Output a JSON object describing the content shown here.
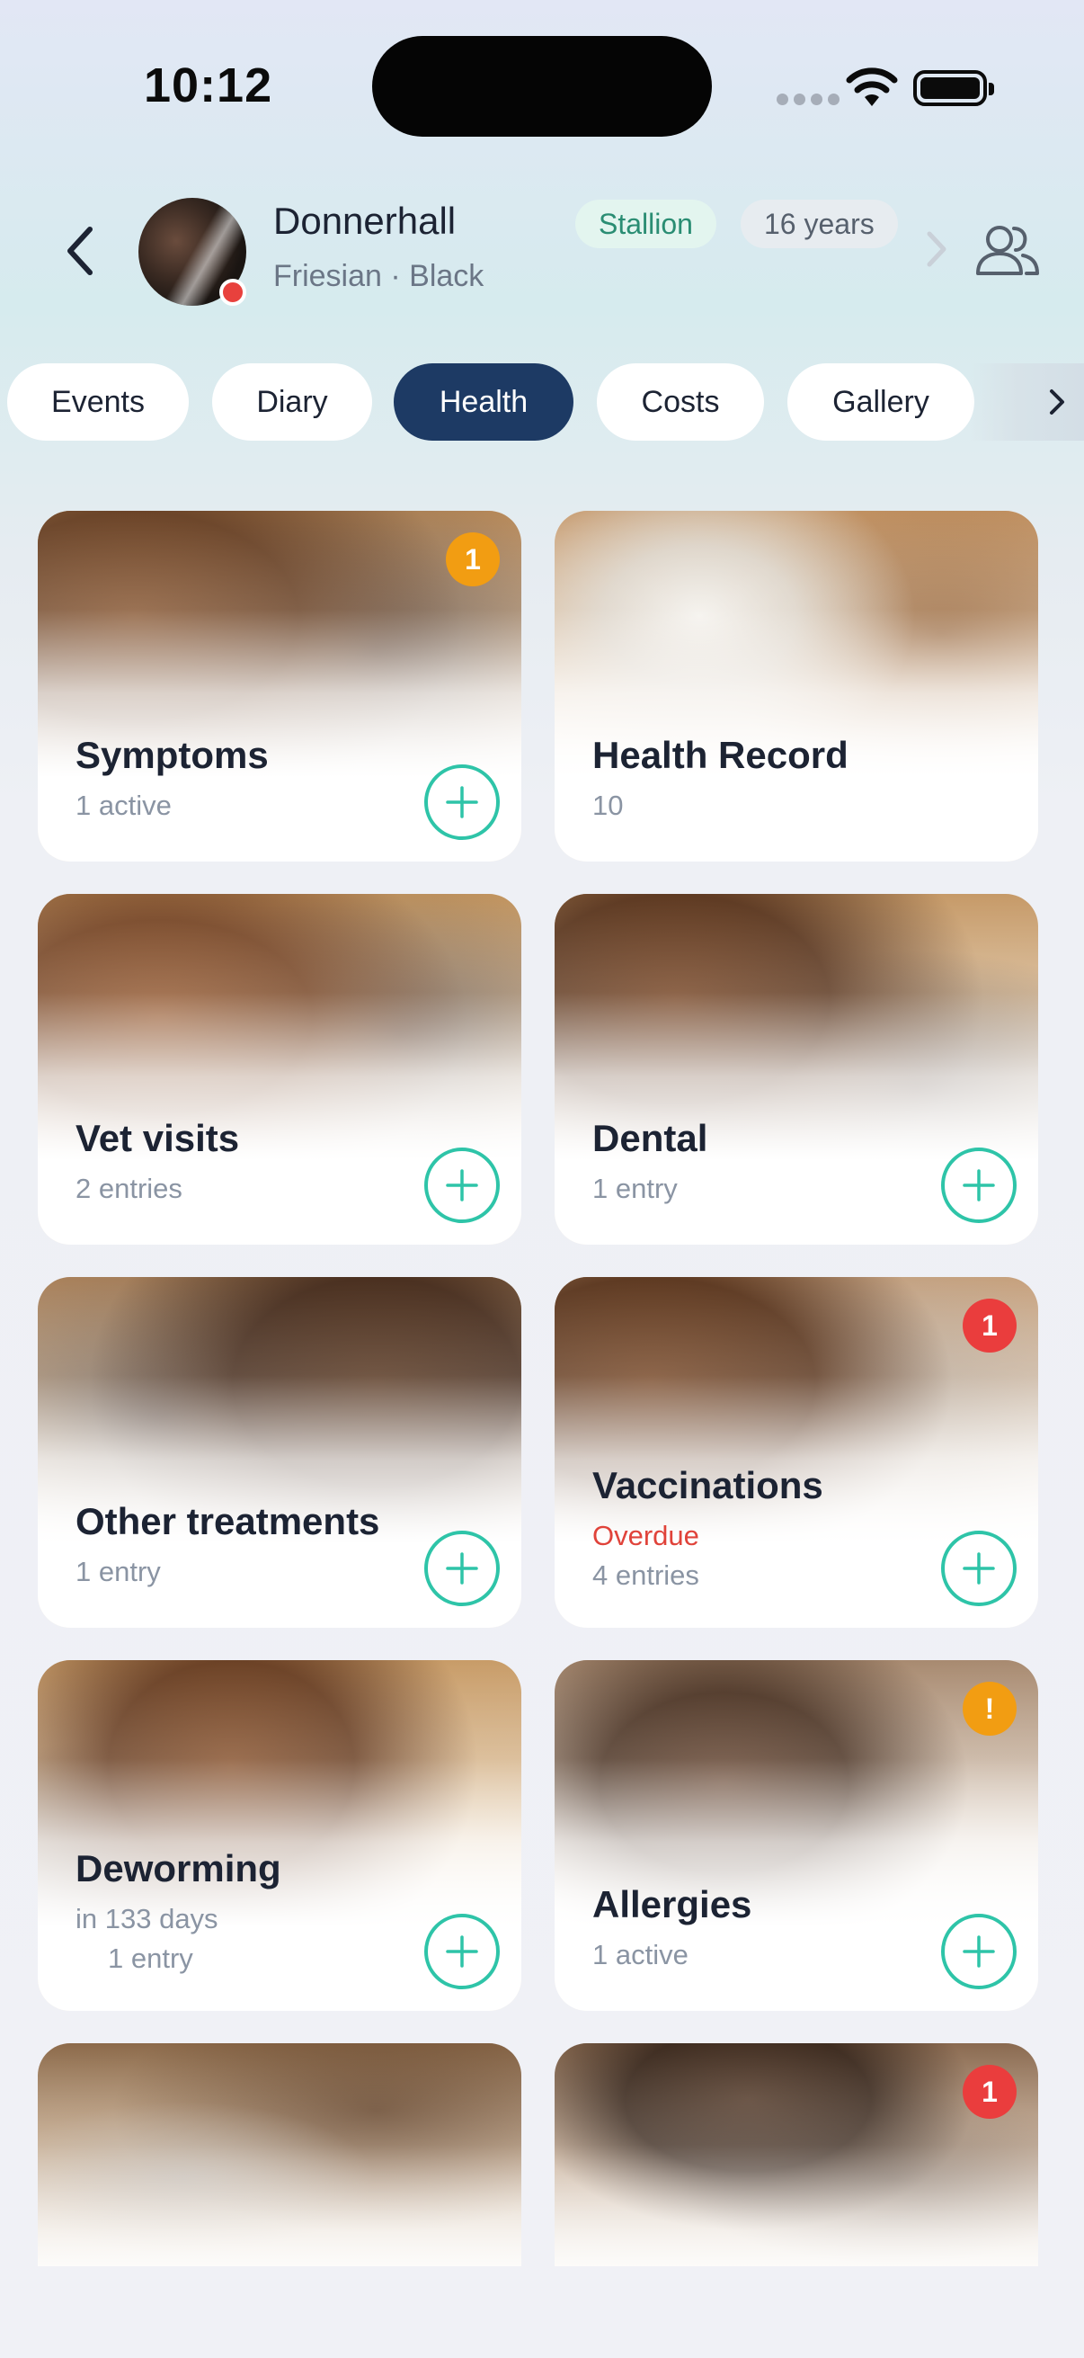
{
  "status_bar": {
    "time": "10:12"
  },
  "header": {
    "horse_name": "Donnerhall",
    "horse_subtitle": "Friesian · Black",
    "tag_gender": "Stallion",
    "tag_age": "16 years",
    "icons": {
      "back": "chevron-left-icon",
      "next": "chevron-right-icon",
      "users": "users-icon"
    }
  },
  "tabs": [
    {
      "label": "Events",
      "active": false
    },
    {
      "label": "Diary",
      "active": false
    },
    {
      "label": "Health",
      "active": true
    },
    {
      "label": "Costs",
      "active": false
    },
    {
      "label": "Gallery",
      "active": false
    }
  ],
  "cards": [
    {
      "title": "Symptoms",
      "line1": "1 active",
      "line2": "",
      "badge": "1",
      "badge_color": "orange"
    },
    {
      "title": "Health Record",
      "line1": "10",
      "line2": "",
      "badge": "",
      "badge_color": ""
    },
    {
      "title": "Vet visits",
      "line1": "2 entries",
      "line2": "",
      "badge": "",
      "badge_color": ""
    },
    {
      "title": "Dental",
      "line1": "1 entry",
      "line2": "",
      "badge": "",
      "badge_color": ""
    },
    {
      "title": "Other treatments",
      "line1": "1 entry",
      "line2": "",
      "badge": "",
      "badge_color": ""
    },
    {
      "title": "Vaccinations",
      "line1": "Overdue",
      "line2": "4 entries",
      "badge": "1",
      "badge_color": "red"
    },
    {
      "title": "Deworming",
      "line1": "in 133 days",
      "line2": "1 entry",
      "badge": "",
      "badge_color": ""
    },
    {
      "title": "Allergies",
      "line1": "1 active",
      "line2": "",
      "badge": "!",
      "badge_color": "orange"
    },
    {
      "title": "",
      "line1": "",
      "line2": "",
      "badge": "",
      "badge_color": ""
    },
    {
      "title": "",
      "line1": "",
      "line2": "",
      "badge": "1",
      "badge_color": "red"
    }
  ],
  "colors": {
    "accent_navy": "#1d3a64",
    "accent_teal": "#2ec4a8",
    "badge_orange": "#f29d12",
    "badge_red": "#ea3d3d",
    "overdue_red": "#e0433a"
  }
}
